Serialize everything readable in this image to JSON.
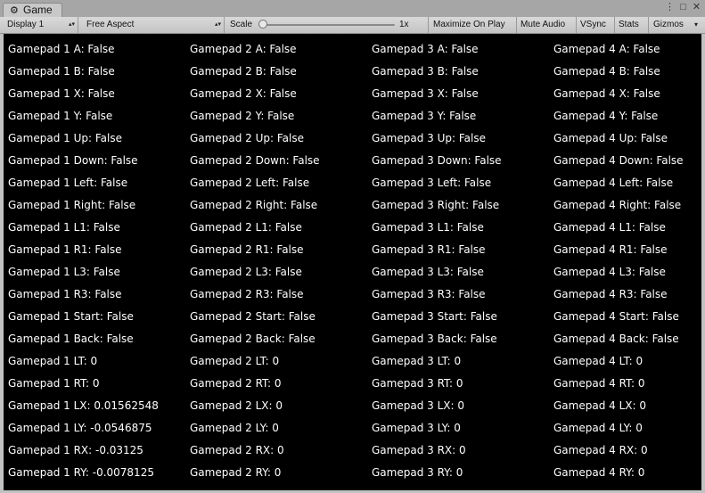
{
  "tab": {
    "title": "Game",
    "icon": "unity-icon"
  },
  "toolbar": {
    "display": "Display 1",
    "aspect": "Free Aspect",
    "scale_label": "Scale",
    "scale_value": "1x",
    "scale_fraction": 0.0,
    "maximize": "Maximize On Play",
    "mute": "Mute Audio",
    "vsync": "VSync",
    "stats": "Stats",
    "gizmos": "Gizmos"
  },
  "gamepads": [
    {
      "lines": [
        "Gamepad 1 A: False",
        "Gamepad 1 B: False",
        "Gamepad 1 X: False",
        "Gamepad 1 Y: False",
        "Gamepad 1 Up: False",
        "Gamepad 1 Down: False",
        "Gamepad 1 Left: False",
        "Gamepad 1 Right: False",
        "Gamepad 1 L1: False",
        "Gamepad 1 R1: False",
        "Gamepad 1 L3: False",
        "Gamepad 1 R3: False",
        "Gamepad 1 Start: False",
        "Gamepad 1 Back: False",
        "Gamepad 1 LT: 0",
        "Gamepad 1 RT: 0",
        "Gamepad 1 LX: 0.01562548",
        "Gamepad 1 LY: -0.0546875",
        "Gamepad 1 RX: -0.03125",
        "Gamepad 1 RY: -0.0078125"
      ]
    },
    {
      "lines": [
        "Gamepad 2 A: False",
        "Gamepad 2 B: False",
        "Gamepad 2 X: False",
        "Gamepad 2 Y: False",
        "Gamepad 2 Up: False",
        "Gamepad 2 Down: False",
        "Gamepad 2 Left: False",
        "Gamepad 2 Right: False",
        "Gamepad 2 L1: False",
        "Gamepad 2 R1: False",
        "Gamepad 2 L3: False",
        "Gamepad 2 R3: False",
        "Gamepad 2 Start: False",
        "Gamepad 2 Back: False",
        "Gamepad 2 LT: 0",
        "Gamepad 2 RT: 0",
        "Gamepad 2 LX: 0",
        "Gamepad 2 LY: 0",
        "Gamepad 2 RX: 0",
        "Gamepad 2 RY: 0"
      ]
    },
    {
      "lines": [
        "Gamepad 3 A: False",
        "Gamepad 3 B: False",
        "Gamepad 3 X: False",
        "Gamepad 3 Y: False",
        "Gamepad 3 Up: False",
        "Gamepad 3 Down: False",
        "Gamepad 3 Left: False",
        "Gamepad 3 Right: False",
        "Gamepad 3 L1: False",
        "Gamepad 3 R1: False",
        "Gamepad 3 L3: False",
        "Gamepad 3 R3: False",
        "Gamepad 3 Start: False",
        "Gamepad 3 Back: False",
        "Gamepad 3 LT: 0",
        "Gamepad 3 RT: 0",
        "Gamepad 3 LX: 0",
        "Gamepad 3 LY: 0",
        "Gamepad 3 RX: 0",
        "Gamepad 3 RY: 0"
      ]
    },
    {
      "lines": [
        "Gamepad 4 A: False",
        "Gamepad 4 B: False",
        "Gamepad 4 X: False",
        "Gamepad 4 Y: False",
        "Gamepad 4 Up: False",
        "Gamepad 4 Down: False",
        "Gamepad 4 Left: False",
        "Gamepad 4 Right: False",
        "Gamepad 4 L1: False",
        "Gamepad 4 R1: False",
        "Gamepad 4 L3: False",
        "Gamepad 4 R3: False",
        "Gamepad 4 Start: False",
        "Gamepad 4 Back: False",
        "Gamepad 4 LT: 0",
        "Gamepad 4 RT: 0",
        "Gamepad 4 LX: 0",
        "Gamepad 4 LY: 0",
        "Gamepad 4 RX: 0",
        "Gamepad 4 RY: 0"
      ]
    }
  ]
}
